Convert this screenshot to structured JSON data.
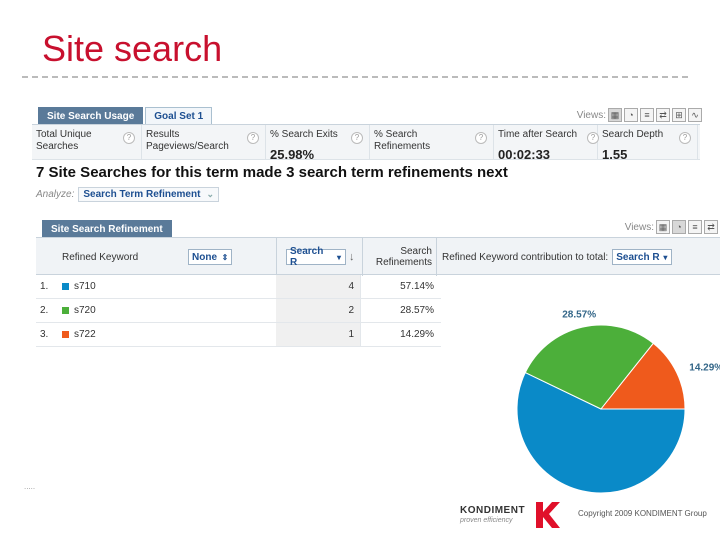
{
  "slide": {
    "title": "Site search",
    "copyright": "Copyright 2009 KONDIMENT Group",
    "logo": {
      "name": "KONDIMENT",
      "tagline": "proven efficiency"
    }
  },
  "top_tabs": [
    {
      "label": "Site Search Usage",
      "active": true
    },
    {
      "label": "Goal Set 1",
      "active": false
    }
  ],
  "views_label": "Views:",
  "metrics": [
    {
      "label": "Total Unique Searches",
      "value": ""
    },
    {
      "label": "Results Pageviews/Search",
      "value": ""
    },
    {
      "label": "% Search Exits",
      "value": "25.98%"
    },
    {
      "label": "% Search Refinements",
      "value": ""
    },
    {
      "label": "Time after Search",
      "value": "00:02:33"
    },
    {
      "label": "Search Depth",
      "value": "1.55"
    }
  ],
  "headline": "7 Site Searches for this term made 3 search term refinements next",
  "analyze": {
    "label": "Analyze:",
    "value": "Search Term Refinement"
  },
  "panel_tab": "Site Search Refinement",
  "table": {
    "col_keyword": "Refined Keyword",
    "segment_select": "None",
    "metric_select": "Search R",
    "col_refinements": "Search Refinements",
    "contribution_label": "Refined Keyword contribution to total:",
    "contribution_select": "Search R",
    "rows": [
      {
        "num": "1.",
        "keyword": "s710",
        "color": "#0a8ac8",
        "count": "4",
        "pct": "57.14%"
      },
      {
        "num": "2.",
        "keyword": "s720",
        "color": "#4caf3a",
        "count": "2",
        "pct": "28.57%"
      },
      {
        "num": "3.",
        "keyword": "s722",
        "color": "#ef5a1c",
        "count": "1",
        "pct": "14.29%"
      }
    ]
  },
  "chart_data": {
    "type": "pie",
    "categories": [
      "s710",
      "s720",
      "s722"
    ],
    "values": [
      57.14,
      28.57,
      14.29
    ],
    "colors": [
      "#0a8ac8",
      "#4caf3a",
      "#ef5a1c"
    ],
    "labels": [
      "57.14%",
      "28.57%",
      "14.29%"
    ]
  }
}
